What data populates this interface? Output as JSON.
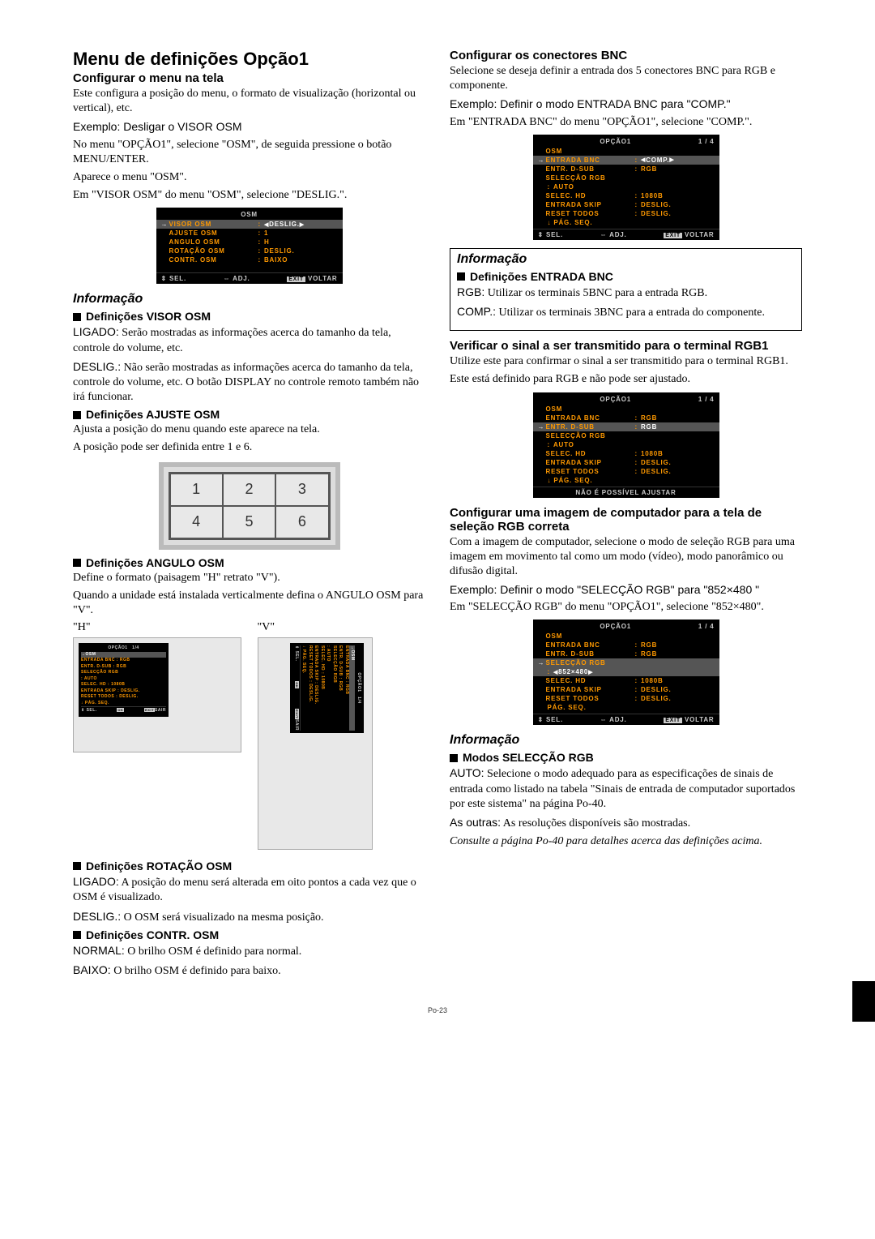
{
  "page_number": "Po-23",
  "left": {
    "main_title": "Menu de definições Opção1",
    "s1_title": "Configurar o menu na tela",
    "s1_p1": "Este configura a posição do menu, o formato de visualização (horizontal ou vertical), etc.",
    "s1_ex": "Exemplo: Desligar o VISOR OSM",
    "s1_p2": "No menu \"OPÇÃO1\", selecione \"OSM\", de seguida pressione o botão MENU/ENTER.",
    "s1_p3": "Aparece o menu \"OSM\".",
    "s1_p4": "Em \"VISOR OSM\" do menu \"OSM\", selecione \"DESLIG.\".",
    "osd1": {
      "title": "OSM",
      "rows": [
        {
          "arrow": "→",
          "label": "VISOR OSM",
          "val": "DESLIG.",
          "active": true,
          "tri": true
        },
        {
          "label": "AJUSTE OSM",
          "colon": ":",
          "val": "1"
        },
        {
          "label": "ANGULO OSM",
          "colon": ":",
          "val": "H"
        },
        {
          "label": "ROTAÇÃO OSM",
          "colon": ":",
          "val": "DESLIG."
        },
        {
          "label": "CONTR. OSM",
          "colon": ":",
          "val": "BAIXO"
        }
      ],
      "foot": {
        "sel": "⇕ SEL.",
        "adj": "⇔ ADJ.",
        "exit": "EXIT",
        "voltar": "VOLTAR"
      }
    },
    "info1_heading": "Informação",
    "d1_title": "Definições VISOR OSM",
    "d1_p1a": "LIGADO:",
    "d1_p1b": " Serão mostradas as informações acerca do tamanho da tela, controle do volume, etc.",
    "d1_p2a": "DESLIG.:",
    "d1_p2b": " Não serão mostradas as informações acerca do tamanho da tela, controle do volume, etc. O botão DISPLAY no controle remoto também não irá funcionar.",
    "d2_title": "Definições AJUSTE OSM",
    "d2_p1": "Ajusta a posição do menu quando este aparece na tela.",
    "d2_p2": "A posição pode ser definida entre 1 e 6.",
    "grid": [
      "1",
      "2",
      "3",
      "4",
      "5",
      "6"
    ],
    "d3_title": "Definições ANGULO OSM",
    "d3_p1": "Define o formato (paisagem \"H\" retrato \"V\").",
    "d3_p2": "Quando a unidade está instalada verticalmente defina o ANGULO OSM para \"V\".",
    "hv_h": "\"H\"",
    "hv_v": "\"V\"",
    "mini_osd": {
      "title": "OPÇÃO1",
      "page": "1/4",
      "rows": [
        "→OSM",
        "ENTRADA BNC      :  RGB",
        "ENTR. D-SUB      :  RGB",
        "SELECÇÃO RGB",
        "             :  AUTO",
        "SELEC. HD        :  1080B",
        "ENTRADA SKIP     :  DESLIG.",
        "RESET TODOS      :  DESLIG.",
        "   ↓ PÁG. SEQ."
      ],
      "foot_sel": "⇕ SEL.",
      "foot_ok": "OK",
      "foot_exit": "EXIT",
      "foot_sair": "SAIR"
    },
    "d4_title": "Definições ROTAÇÃO OSM",
    "d4_p1a": "LIGADO:",
    "d4_p1b": " A posição do menu será alterada em oito pontos a cada vez que o OSM é visualizado.",
    "d4_p2a": "DESLIG.:",
    "d4_p2b": " O OSM será visualizado na mesma posição.",
    "d5_title": "Definições CONTR. OSM",
    "d5_p1a": "NORMAL:",
    "d5_p1b": " O brilho OSM é definido para normal.",
    "d5_p2a": "BAIXO:",
    "d5_p2b": " O brilho OSM é definido para baixo."
  },
  "right": {
    "s1_title": "Configurar os conectores BNC",
    "s1_p1": "Selecione se deseja definir a entrada dos 5 conectores BNC para RGB e componente.",
    "s1_ex": "Exemplo: Definir o modo ENTRADA BNC para \"COMP.\"",
    "s1_p2": "Em \"ENTRADA BNC\" do menu \"OPÇÃO1\", selecione \"COMP.\".",
    "osd2": {
      "title": "OPÇÃO1",
      "page": "1 / 4",
      "rows": [
        {
          "label": "OSM"
        },
        {
          "arrow": "→",
          "label": "ENTRADA BNC",
          "colon": ":",
          "val": "COMP.",
          "active": true,
          "tri": true
        },
        {
          "label": "ENTR. D-SUB",
          "colon": ":",
          "val": "RGB"
        },
        {
          "label": "SELECÇÃO RGB"
        },
        {
          "sub": true,
          "colon": ":",
          "val": "AUTO"
        },
        {
          "label": "SELEC. HD",
          "colon": ":",
          "val": "1080B"
        },
        {
          "label": "ENTRADA SKIP",
          "colon": ":",
          "val": "DESLIG."
        },
        {
          "label": "RESET TODOS",
          "colon": ":",
          "val": "DESLIG."
        },
        {
          "sub": true,
          "label": "↓ PÁG. SEQ."
        }
      ],
      "foot": {
        "sel": "⇕ SEL.",
        "adj": "⇔ ADJ.",
        "exit": "EXIT",
        "voltar": "VOLTAR"
      }
    },
    "info2_heading": "Informação",
    "d1_title": "Definições ENTRADA BNC",
    "d1_p1a": "RGB:",
    "d1_p1b": " Utilizar os terminais 5BNC para a entrada RGB.",
    "d1_p2a": "COMP.:",
    "d1_p2b": " Utilizar os terminais 3BNC para a entrada do componente.",
    "s2_title": "Verificar o sinal a ser transmitido para o terminal RGB1",
    "s2_p1": "Utilize este para confirmar o sinal a ser transmitido para o terminal RGB1.",
    "s2_p2": "Este está definido para RGB e não pode ser ajustado.",
    "osd3": {
      "title": "OPÇÃO1",
      "page": "1 / 4",
      "rows": [
        {
          "label": "OSM"
        },
        {
          "label": "ENTRADA BNC",
          "colon": ":",
          "val": "RGB"
        },
        {
          "arrow": "→",
          "label": "ENTR. D-SUB",
          "colon": ":",
          "val": "RGB",
          "active": true
        },
        {
          "label": "SELECÇÃO RGB"
        },
        {
          "sub": true,
          "colon": ":",
          "val": "AUTO"
        },
        {
          "label": "SELEC. HD",
          "colon": ":",
          "val": "1080B"
        },
        {
          "label": "ENTRADA SKIP",
          "colon": ":",
          "val": "DESLIG."
        },
        {
          "label": "RESET TODOS",
          "colon": ":",
          "val": "DESLIG."
        },
        {
          "sub": true,
          "label": "↓ PÁG. SEQ."
        }
      ],
      "foot_single": "NÃO É POSSÍVEL AJUSTAR"
    },
    "s3_title": "Configurar uma imagem de computador para a tela de seleção RGB correta",
    "s3_p1": "Com a imagem de computador, selecione o modo de seleção RGB para uma imagem em movimento tal como um modo (vídeo), modo panorâmico ou difusão digital.",
    "s3_ex": "Exemplo: Definir o modo \"SELECÇÃO RGB\" para \"852×480 \"",
    "s3_p2": "Em \"SELECÇÃO RGB\" do menu \"OPÇÃO1\", selecione \"852×480\".",
    "osd4": {
      "title": "OPÇÃO1",
      "page": "1 / 4",
      "rows": [
        {
          "label": "OSM"
        },
        {
          "label": "ENTRADA BNC",
          "colon": ":",
          "val": "RGB"
        },
        {
          "label": "ENTR. D-SUB",
          "colon": ":",
          "val": "RGB"
        },
        {
          "arrow": "→",
          "label": "SELECÇÃO RGB",
          "active": true
        },
        {
          "sub": true,
          "val": "852×480",
          "active": true,
          "tri": true
        },
        {
          "label": "SELEC. HD",
          "colon": ":",
          "val": "1080B"
        },
        {
          "label": "ENTRADA SKIP",
          "colon": ":",
          "val": "DESLIG."
        },
        {
          "label": "RESET TODOS",
          "colon": ":",
          "val": "DESLIG."
        },
        {
          "sub": true,
          "label": "PÁG. SEQ."
        }
      ],
      "foot": {
        "sel": "⇕ SEL.",
        "adj": "⇔ ADJ.",
        "exit": "EXIT",
        "voltar": "VOLTAR"
      }
    },
    "info3_heading": "Informação",
    "d3_title": "Modos SELECÇÃO RGB",
    "d3_p1a": "AUTO:",
    "d3_p1b": " Selecione o modo adequado para as especificações de sinais de entrada como listado na tabela \"Sinais de entrada de computador suportados por este sistema\" na página Po-40.",
    "d3_p2a": "As outras:",
    "d3_p2b": " As resoluções disponíveis são mostradas.",
    "d3_p3": "Consulte a página Po-40 para detalhes acerca das definições acima."
  }
}
